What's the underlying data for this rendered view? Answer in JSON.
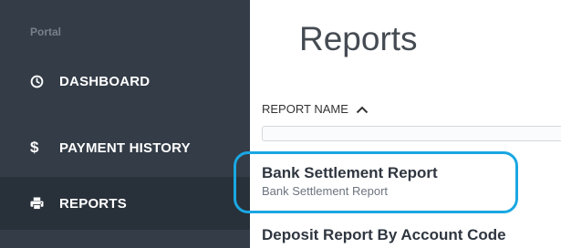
{
  "sidebar": {
    "portal_label": "Portal",
    "items": [
      {
        "label": "DASHBOARD",
        "icon": "clock-icon"
      },
      {
        "label": "PAYMENT HISTORY",
        "icon": "dollar-icon"
      },
      {
        "label": "REPORTS",
        "icon": "printer-icon",
        "active": true
      }
    ]
  },
  "main": {
    "title": "Reports",
    "table": {
      "column_header": "REPORT NAME",
      "rows": [
        {
          "title": "Bank Settlement Report",
          "subtitle": "Bank Settlement Report"
        },
        {
          "title": "Deposit Report By Account Code"
        }
      ]
    }
  },
  "colors": {
    "sidebar_bg": "#333c47",
    "sidebar_active_bg": "#28303a",
    "highlight": "#1aa7e2"
  }
}
